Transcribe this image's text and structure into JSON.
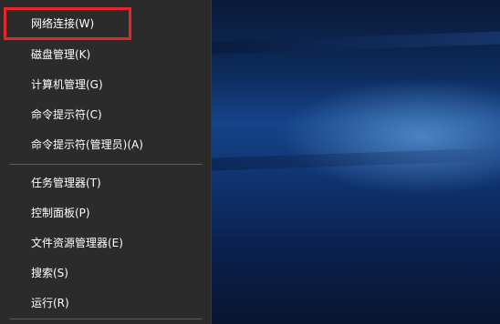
{
  "menu": {
    "items": [
      {
        "label": "网络连接(W)"
      },
      {
        "label": "磁盘管理(K)"
      },
      {
        "label": "计算机管理(G)"
      },
      {
        "label": "命令提示符(C)"
      },
      {
        "label": "命令提示符(管理员)(A)"
      },
      {
        "label": "任务管理器(T)"
      },
      {
        "label": "控制面板(P)"
      },
      {
        "label": "文件资源管理器(E)"
      },
      {
        "label": "搜索(S)"
      },
      {
        "label": "运行(R)"
      }
    ]
  },
  "highlight": {
    "target": "网络连接(W)",
    "color": "#e8242f"
  },
  "colors": {
    "menu_background": "#2b2b2b",
    "menu_text": "#ffffff",
    "divider": "#5a5a5a"
  }
}
